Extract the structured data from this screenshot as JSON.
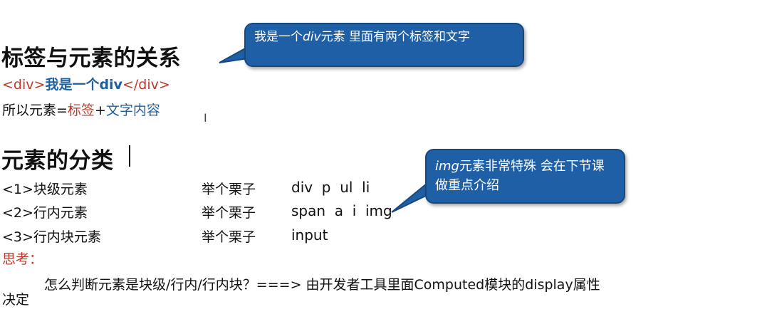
{
  "section1": {
    "title": "标签与元素的关系",
    "code_open": "<div>",
    "code_text": "我是一个div",
    "code_close": "</div>",
    "formula_prefix": "所以元素=",
    "formula_tag": "标签",
    "formula_plus": "+",
    "formula_text": "文字内容"
  },
  "callout1": {
    "part1": "我是一个",
    "part_italic": "div",
    "part2": "元素 里面有两个标签和文字"
  },
  "section2": {
    "title": "元素的分类",
    "items": [
      {
        "label": "<1>块级元素",
        "example_label": "举个栗子",
        "examples": "div  p  ul  li"
      },
      {
        "label": "<2>行内元素",
        "example_label": "举个栗子",
        "examples": "span  a  i  img"
      },
      {
        "label": "<3>行内块元素",
        "example_label": "举个栗子",
        "examples": "input"
      }
    ],
    "think_label": "思考：",
    "question": "怎么判断元素是块级/行内/行内块？===> 由开发者工具里面Computed模块的display属性",
    "question_cont": "决定"
  },
  "callout2": {
    "part_italic": "img",
    "part1": "元素非常特殊  会在下节课做重点介绍"
  },
  "colors": {
    "callout_fill": "#1f5fa6",
    "red_text": "#c0392b",
    "blue_text": "#1f5f9e"
  }
}
